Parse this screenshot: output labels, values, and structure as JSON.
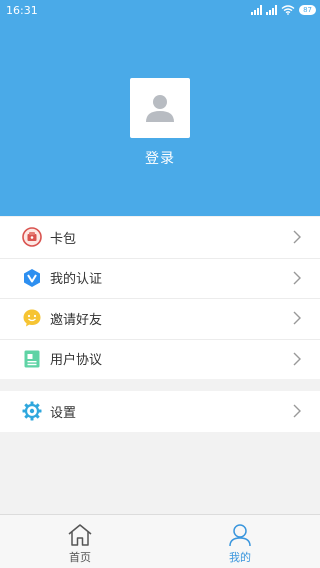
{
  "status": {
    "time": "16:31",
    "battery": "87"
  },
  "profile": {
    "login_label": "登录"
  },
  "menu": {
    "items": [
      {
        "label": "卡包",
        "icon": "card-wallet-icon"
      },
      {
        "label": "我的认证",
        "icon": "verification-icon"
      },
      {
        "label": "邀请好友",
        "icon": "invite-friends-icon"
      },
      {
        "label": "用户协议",
        "icon": "user-agreement-icon"
      }
    ],
    "settings": {
      "label": "设置",
      "icon": "settings-gear-icon"
    }
  },
  "tabbar": {
    "home_label": "首页",
    "mine_label": "我的"
  },
  "colors": {
    "header_bg": "#4aaae8",
    "active_tab": "#3a96dd"
  }
}
